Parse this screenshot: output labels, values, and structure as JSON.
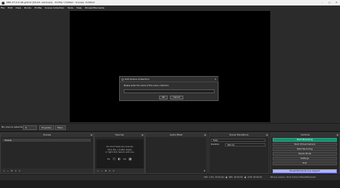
{
  "window": {
    "title": "OBS 27.0.0-46-gd1d1 (64-bit, windows) - Profile: Untitled - Scenes: Untitled",
    "controls": [
      "–",
      "□",
      "✕"
    ]
  },
  "menu": [
    "File",
    "Edit",
    "View",
    "Docks",
    "Profile",
    "Scene Collection",
    "Tools",
    "Help",
    "StreamElements"
  ],
  "dialog": {
    "title": "Add Scene Collection",
    "prompt": "Please enter the name of the scene collection",
    "input_value": "",
    "ok_label": "OK",
    "cancel_label": "Cancel"
  },
  "status_line": {
    "no_source": "No source selected",
    "properties_label": "Properties",
    "filters_label": "Filters"
  },
  "docks": {
    "scenes": {
      "title": "Scenes",
      "items": [
        "Scene"
      ]
    },
    "sources": {
      "title": "Sources",
      "empty_text": [
        "You don't have any sources.",
        "Click the + button below,",
        "or right click here to add one."
      ]
    },
    "audio_mixer": {
      "title": "Audio Mixer"
    },
    "scene_transitions": {
      "title": "Scene Transitions",
      "transition": "Fade",
      "duration_label": "Duration",
      "duration_value": "300 ms"
    },
    "controls": {
      "title": "Controls",
      "buttons": [
        "Start Streaming",
        "Start Virtual Camera",
        "Start Recording",
        "Studio Mode",
        "Settings",
        "Exit",
        "StreamElements Live Support"
      ]
    }
  },
  "bottom_bar": {
    "cpu": "CPU: 1.6%, 30.00 fps",
    "rec": "REC: 00:00:00",
    "live": "LIVE: 00:00:00",
    "version": "SE.Live version: 20.0.4.42 by StreamElements"
  },
  "colors": {
    "start_streaming": "#1f8a6f",
    "live_support": "#b0b4ff",
    "preview": "#000000"
  }
}
